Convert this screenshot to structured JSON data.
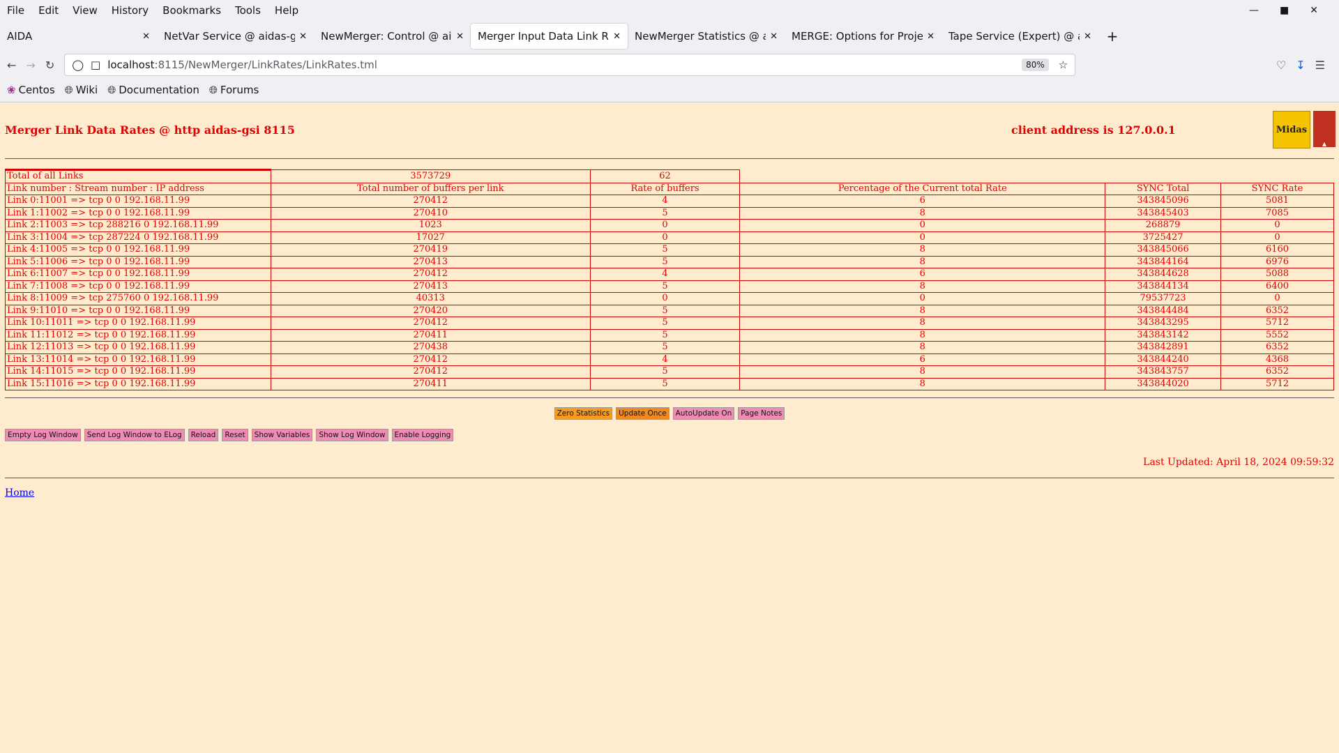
{
  "menu": [
    "File",
    "Edit",
    "View",
    "History",
    "Bookmarks",
    "Tools",
    "Help"
  ],
  "tabs": [
    {
      "label": "AIDA",
      "active": false
    },
    {
      "label": "NetVar Service @ aidas-gsi",
      "active": false
    },
    {
      "label": "NewMerger: Control @ aidas",
      "active": false
    },
    {
      "label": "Merger Input Data Link Rates",
      "active": true
    },
    {
      "label": "NewMerger Statistics @ aida",
      "active": false
    },
    {
      "label": "MERGE: Options for Project N",
      "active": false
    },
    {
      "label": "Tape Service (Expert) @ aida",
      "active": false
    }
  ],
  "url": {
    "host": "localhost",
    "path": ":8115/NewMerger/LinkRates/LinkRates.tml"
  },
  "zoom": "80%",
  "bookmarks": [
    "Centos",
    "Wiki",
    "Documentation",
    "Forums"
  ],
  "page": {
    "title": "Merger Link Data Rates @ http aidas-gsi 8115",
    "client": "client address is 127.0.0.1",
    "logo_text": "Midas"
  },
  "totals": {
    "label": "Total of all Links",
    "buffers": "3573729",
    "rate": "62"
  },
  "headers": [
    "Link number : Stream number : IP address",
    "Total number of buffers per link",
    "Rate of buffers",
    "Percentage of the Current total Rate",
    "SYNC Total",
    "SYNC Rate"
  ],
  "rows": [
    [
      "Link 0:11001 => tcp 0 0 192.168.11.99",
      "270412",
      "4",
      "6",
      "343845096",
      "5081"
    ],
    [
      "Link 1:11002 => tcp 0 0 192.168.11.99",
      "270410",
      "5",
      "8",
      "343845403",
      "7085"
    ],
    [
      "Link 2:11003 => tcp 288216 0 192.168.11.99",
      "1023",
      "0",
      "0",
      "268879",
      "0"
    ],
    [
      "Link 3:11004 => tcp 287224 0 192.168.11.99",
      "17027",
      "0",
      "0",
      "3725427",
      "0"
    ],
    [
      "Link 4:11005 => tcp 0 0 192.168.11.99",
      "270419",
      "5",
      "8",
      "343845066",
      "6160"
    ],
    [
      "Link 5:11006 => tcp 0 0 192.168.11.99",
      "270413",
      "5",
      "8",
      "343844164",
      "6976"
    ],
    [
      "Link 6:11007 => tcp 0 0 192.168.11.99",
      "270412",
      "4",
      "6",
      "343844628",
      "5088"
    ],
    [
      "Link 7:11008 => tcp 0 0 192.168.11.99",
      "270413",
      "5",
      "8",
      "343844134",
      "6400"
    ],
    [
      "Link 8:11009 => tcp 275760 0 192.168.11.99",
      "40313",
      "0",
      "0",
      "79537723",
      "0"
    ],
    [
      "Link 9:11010 => tcp 0 0 192.168.11.99",
      "270420",
      "5",
      "8",
      "343844484",
      "6352"
    ],
    [
      "Link 10:11011 => tcp 0 0 192.168.11.99",
      "270412",
      "5",
      "8",
      "343843295",
      "5712"
    ],
    [
      "Link 11:11012 => tcp 0 0 192.168.11.99",
      "270411",
      "5",
      "8",
      "343843142",
      "5552"
    ],
    [
      "Link 12:11013 => tcp 0 0 192.168.11.99",
      "270438",
      "5",
      "8",
      "343842891",
      "6352"
    ],
    [
      "Link 13:11014 => tcp 0 0 192.168.11.99",
      "270412",
      "4",
      "6",
      "343844240",
      "4368"
    ],
    [
      "Link 14:11015 => tcp 0 0 192.168.11.99",
      "270412",
      "5",
      "8",
      "343843757",
      "6352"
    ],
    [
      "Link 15:11016 => tcp 0 0 192.168.11.99",
      "270411",
      "5",
      "8",
      "343844020",
      "5712"
    ]
  ],
  "stat_buttons": [
    {
      "label": "Zero Statistics",
      "color": "#f59a23"
    },
    {
      "label": "Update Once",
      "color": "#f08a20"
    },
    {
      "label": "AutoUpdate On",
      "color": "#f08cb4"
    },
    {
      "label": "Page Notes",
      "color": "#f08cb4"
    }
  ],
  "log_buttons": [
    "Empty Log Window",
    "Send Log Window to ELog",
    "Reload",
    "Reset",
    "Show Variables",
    "Show Log Window",
    "Enable Logging"
  ],
  "last_updated": "Last Updated: April 18, 2024 09:59:32",
  "home_link": "Home"
}
